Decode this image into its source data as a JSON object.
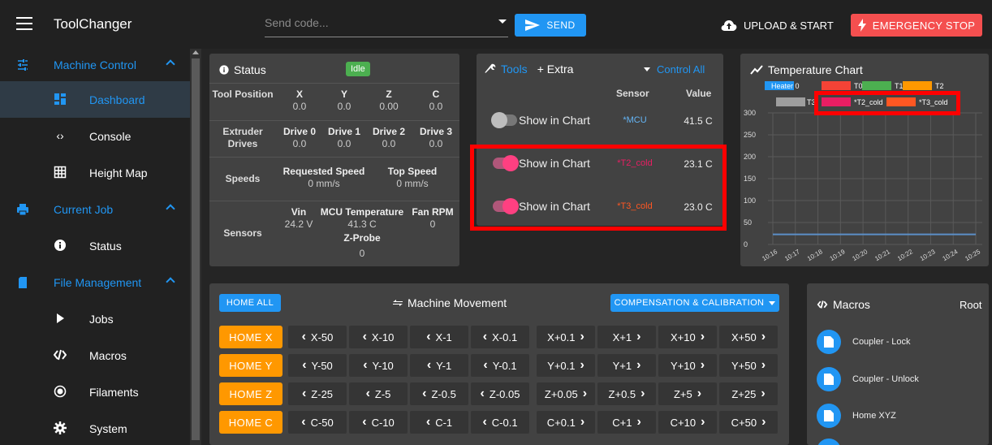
{
  "app": {
    "title": "ToolChanger"
  },
  "topbar": {
    "code_placeholder": "Send code...",
    "send_label": "SEND",
    "upload_label": "UPLOAD & START",
    "estop_label": "EMERGENCY STOP"
  },
  "sidebar": {
    "groups": [
      {
        "label": "Machine Control",
        "icon": "sliders-icon"
      },
      {
        "label": "Current Job",
        "icon": "printer-icon"
      },
      {
        "label": "File Management",
        "icon": "sd-card-icon"
      }
    ],
    "items": [
      {
        "label": "Dashboard",
        "icon": "dashboard-icon",
        "active": true
      },
      {
        "label": "Console",
        "icon": "code-icon"
      },
      {
        "label": "Height Map",
        "icon": "grid-icon"
      },
      {
        "label": "Status",
        "icon": "info-icon"
      },
      {
        "label": "Jobs",
        "icon": "play-icon"
      },
      {
        "label": "Macros",
        "icon": "macro-icon"
      },
      {
        "label": "Filaments",
        "icon": "radio-icon"
      },
      {
        "label": "System",
        "icon": "gear-icon"
      }
    ]
  },
  "status": {
    "title": "Status",
    "state": "Idle",
    "tool_position": {
      "label": "Tool Position",
      "axes": [
        {
          "name": "X",
          "value": "0.0"
        },
        {
          "name": "Y",
          "value": "0.0"
        },
        {
          "name": "Z",
          "value": "0.00"
        },
        {
          "name": "C",
          "value": "0.0"
        }
      ]
    },
    "extruder_drives": {
      "label": "Extruder Drives",
      "drives": [
        {
          "name": "Drive 0",
          "value": "0.0"
        },
        {
          "name": "Drive 1",
          "value": "0.0"
        },
        {
          "name": "Drive 2",
          "value": "0.0"
        },
        {
          "name": "Drive 3",
          "value": "0.0"
        }
      ]
    },
    "speeds": {
      "label": "Speeds",
      "requested_label": "Requested Speed",
      "requested_value": "0 mm/s",
      "top_label": "Top Speed",
      "top_value": "0 mm/s"
    },
    "sensors": {
      "label": "Sensors",
      "vin_label": "Vin",
      "vin_value": "24.2 V",
      "mcu_label": "MCU Temperature",
      "mcu_value": "41.3 C",
      "fan_label": "Fan RPM",
      "fan_value": "0",
      "zprobe_label": "Z-Probe",
      "zprobe_value": "0"
    }
  },
  "tools": {
    "tab_tools": "Tools",
    "tab_extra": "+ Extra",
    "control_all": "Control All",
    "col_sensor": "Sensor",
    "col_value": "Value",
    "rows": [
      {
        "label": "Show in Chart",
        "on": false,
        "sensor": "*MCU",
        "sensor_color": "#64b5f6",
        "value": "41.5 C"
      },
      {
        "label": "Show in Chart",
        "on": true,
        "sensor": "*T2_cold",
        "sensor_color": "#e91e63",
        "value": "23.1 C"
      },
      {
        "label": "Show in Chart",
        "on": true,
        "sensor": "*T3_cold",
        "sensor_color": "#ff5722",
        "value": "23.0 C"
      }
    ]
  },
  "temperature_chart": {
    "title": "Temperature Chart",
    "chart_data": {
      "type": "line",
      "legend": [
        {
          "name": "Heater 0",
          "color": "#2196f3"
        },
        {
          "name": "T0",
          "color": "#f44336"
        },
        {
          "name": "T1",
          "color": "#4caf50"
        },
        {
          "name": "T2",
          "color": "#ff9800"
        },
        {
          "name": "T3",
          "color": "#9e9e9e"
        },
        {
          "name": "*T2_cold",
          "color": "#e91e63"
        },
        {
          "name": "*T3_cold",
          "color": "#ff5722"
        }
      ],
      "ylim": [
        0,
        300
      ],
      "yticks": [
        0,
        50,
        100,
        150,
        200,
        250,
        300
      ],
      "xticks": [
        "10:16",
        "10:17",
        "10:18",
        "10:19",
        "10:20",
        "10:21",
        "10:22",
        "10:23",
        "10:24",
        "10:25"
      ],
      "series": [
        {
          "name": "Heater 0",
          "values": [
            23,
            23,
            23,
            23,
            23,
            23,
            23,
            23,
            23,
            23
          ]
        }
      ],
      "grid": true,
      "legend_position": "top"
    }
  },
  "movement": {
    "home_all": "HOME ALL",
    "title": "Machine Movement",
    "compensation": "COMPENSATION & CALIBRATION",
    "rows": [
      {
        "home": "HOME X",
        "jogs": [
          "X-50",
          "X-10",
          "X-1",
          "X-0.1",
          "X+0.1",
          "X+1",
          "X+10",
          "X+50"
        ]
      },
      {
        "home": "HOME Y",
        "jogs": [
          "Y-50",
          "Y-10",
          "Y-1",
          "Y-0.1",
          "Y+0.1",
          "Y+1",
          "Y+10",
          "Y+50"
        ]
      },
      {
        "home": "HOME Z",
        "jogs": [
          "Z-25",
          "Z-5",
          "Z-0.5",
          "Z-0.05",
          "Z+0.05",
          "Z+0.5",
          "Z+5",
          "Z+25"
        ]
      },
      {
        "home": "HOME C",
        "jogs": [
          "C-50",
          "C-10",
          "C-1",
          "C-0.1",
          "C+0.1",
          "C+1",
          "C+10",
          "C+50"
        ]
      }
    ]
  },
  "macros": {
    "title": "Macros",
    "root": "Root",
    "items": [
      {
        "label": "Coupler - Lock"
      },
      {
        "label": "Coupler - Unlock"
      },
      {
        "label": "Home XYZ"
      }
    ]
  }
}
